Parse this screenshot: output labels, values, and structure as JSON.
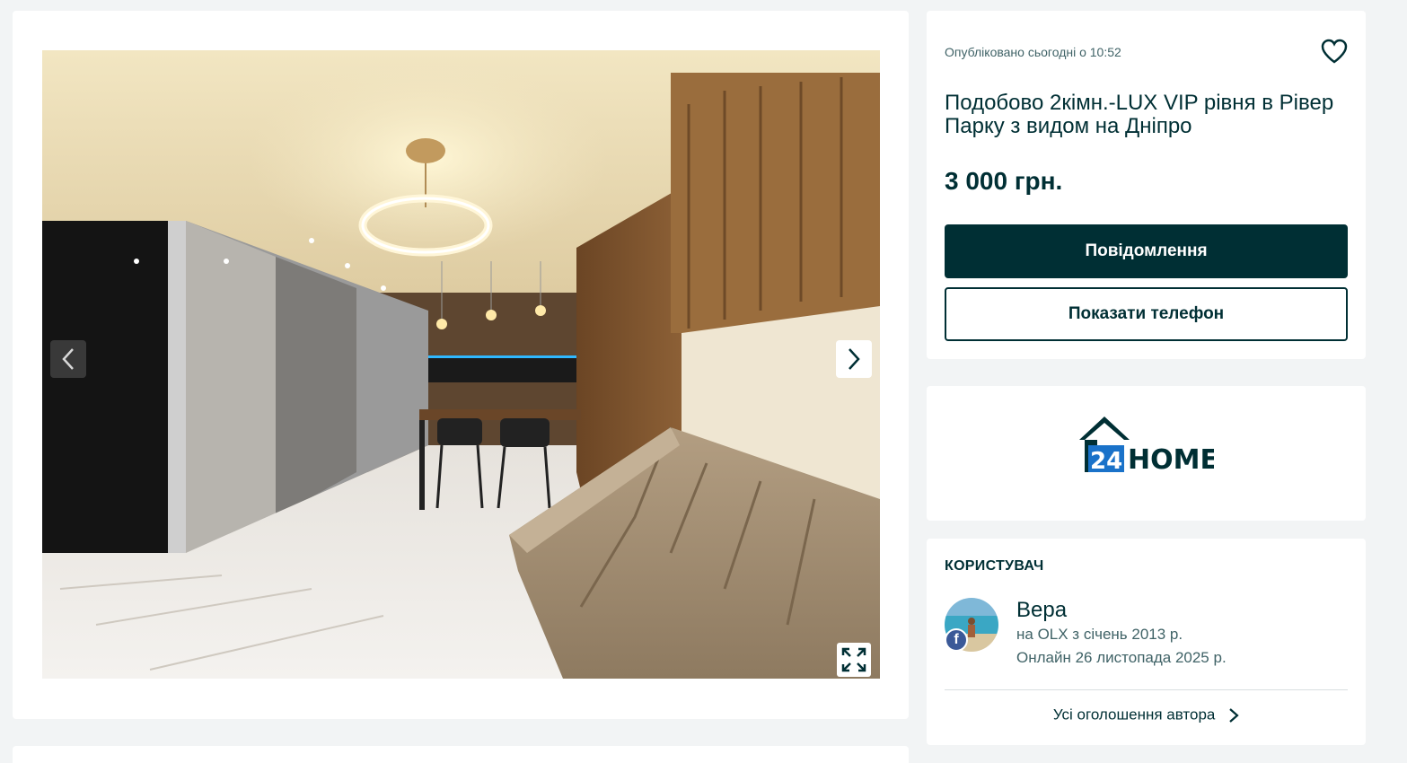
{
  "gallery": {
    "photo_alt": "",
    "prev_icon": "chevron-left-icon",
    "next_icon": "chevron-right-icon",
    "fullscreen_icon": "expand-icon"
  },
  "ad": {
    "posted": "Опубліковано сьогодні о 10:52",
    "favorite_icon": "heart-icon",
    "title": "Подобово 2кімн.-LUX VIP рівня в Рівер Парку з видом на Дніпро",
    "price": "3 000 грн.",
    "message_button": "Повідомлення",
    "phone_button": "Показати телефон"
  },
  "company": {
    "logo_number": "24",
    "logo_word": "HOME",
    "logo_color": "#1a72c9"
  },
  "user": {
    "section_title": "КОРИСТУВАЧ",
    "name": "Вера",
    "since": "на OLX з січень 2013 р.",
    "online": "Онлайн 26 листопада 2025 р.",
    "badge": "f",
    "all_ads_link": "Усі оголошення автора"
  },
  "colors": {
    "page_bg": "#f2f4f5",
    "primary": "#002f34",
    "secondary_text": "#406367",
    "facebook": "#3b5998"
  }
}
